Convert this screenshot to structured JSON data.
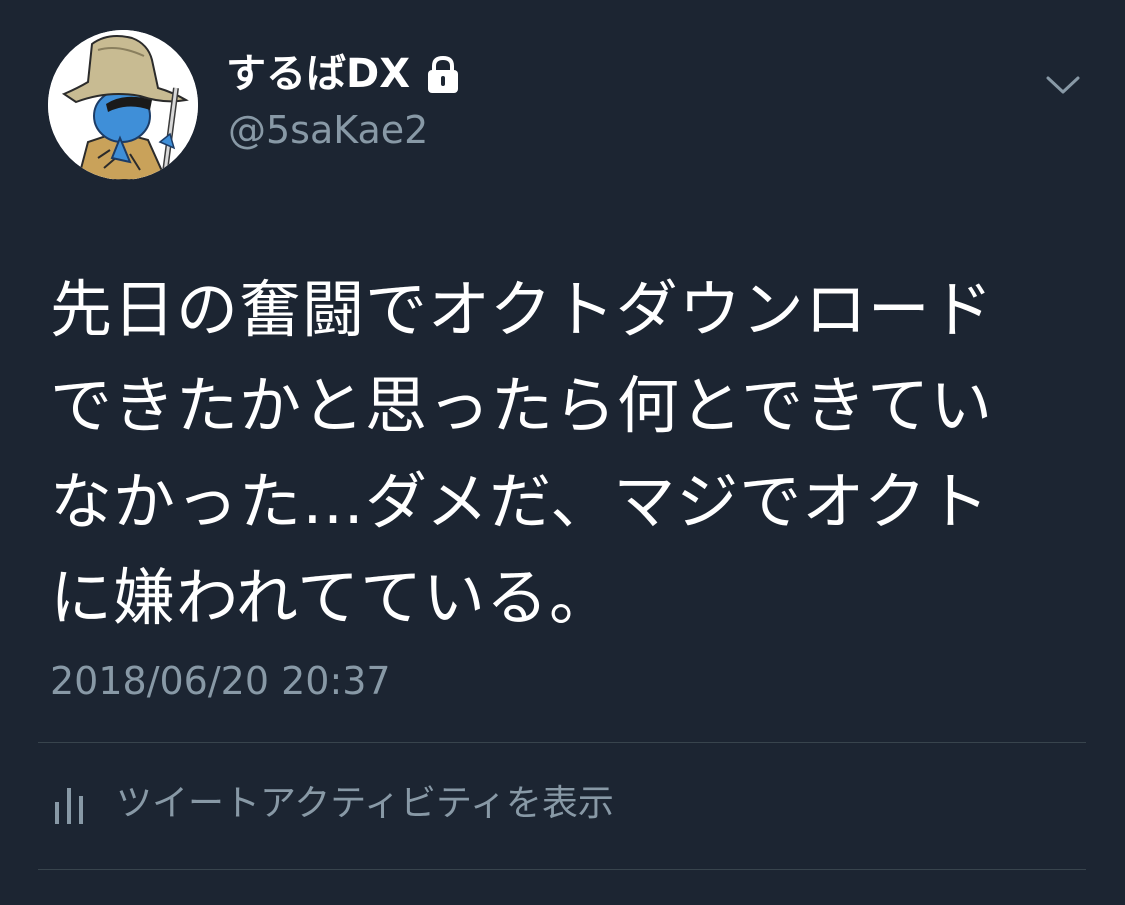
{
  "user": {
    "display_name": "するばDX",
    "handle": "@5saKae2",
    "protected_icon": "lock-icon",
    "avatar": "avatar-illustration"
  },
  "menu": {
    "icon": "chevron-down-icon"
  },
  "tweet": {
    "text": "先日の奮闘でオクトダウンロード\nできたかと思ったら何とできてい\nなかった…ダメだ、マジでオクト\nに嫌われてている。",
    "timestamp": "2018/06/20 20:37"
  },
  "activity": {
    "icon": "bar-chart-icon",
    "label": "ツイートアクティビティを表示"
  },
  "colors": {
    "background": "#1c2532",
    "text_primary": "#ffffff",
    "text_secondary": "#8899a6",
    "divider": "#38444d"
  }
}
